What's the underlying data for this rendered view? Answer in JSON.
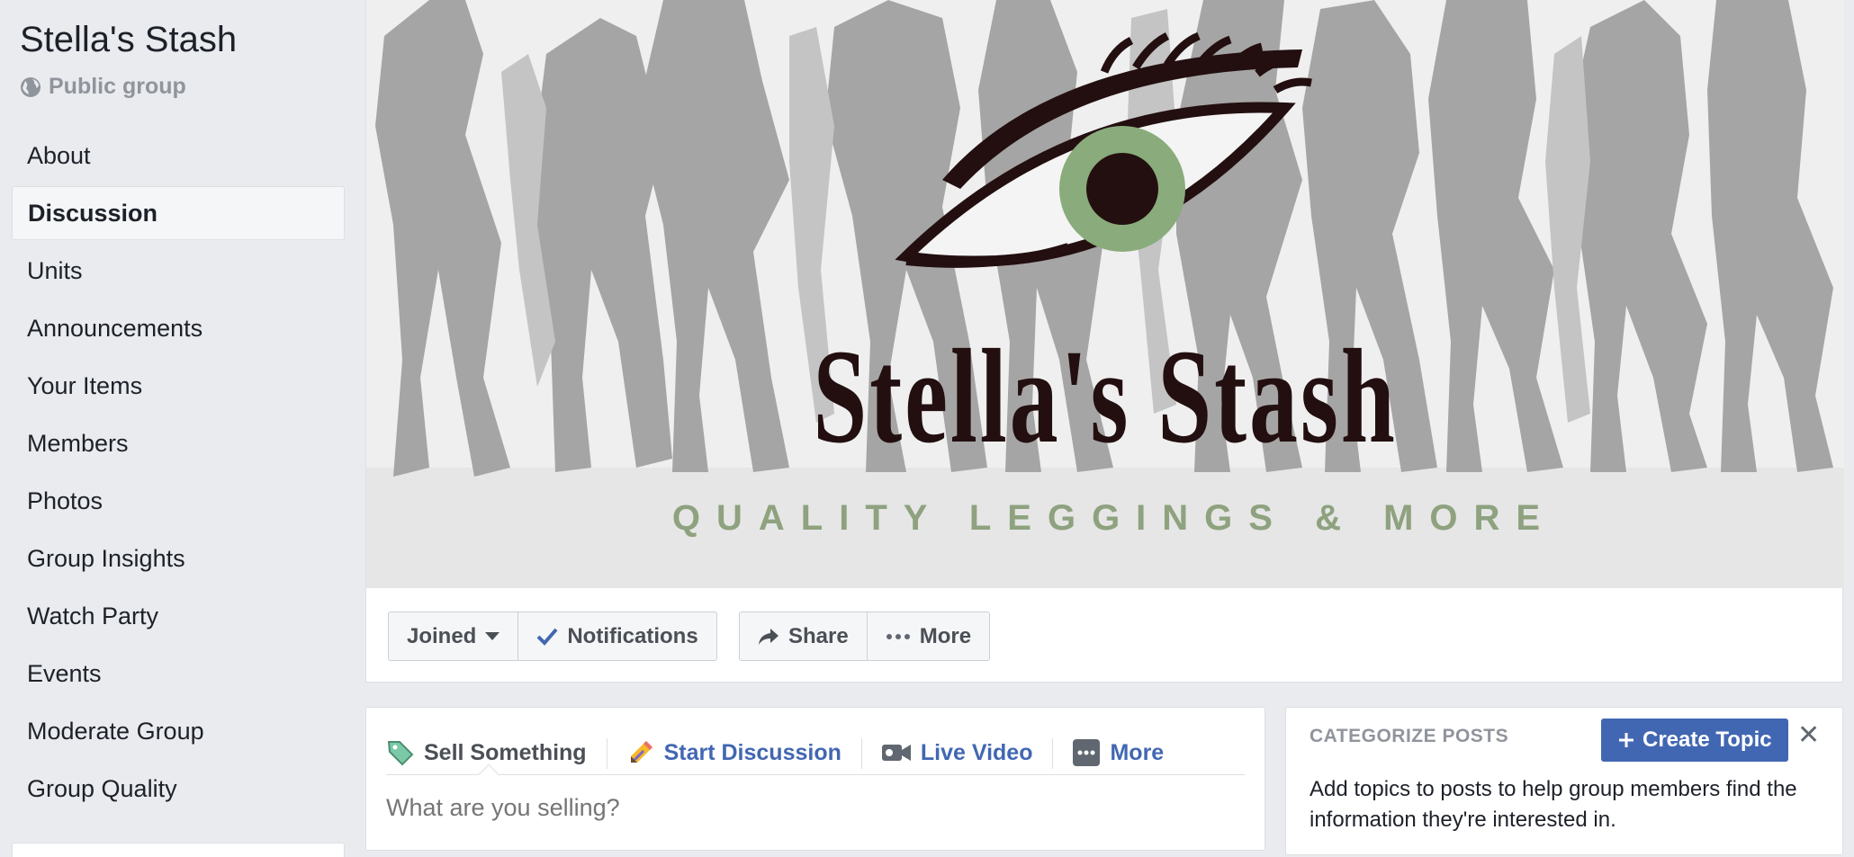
{
  "group": {
    "name": "Stella's Stash",
    "privacy": "Public group"
  },
  "sidebar": {
    "items": [
      {
        "label": "About",
        "active": false
      },
      {
        "label": "Discussion",
        "active": true
      },
      {
        "label": "Units",
        "active": false
      },
      {
        "label": "Announcements",
        "active": false
      },
      {
        "label": "Your Items",
        "active": false
      },
      {
        "label": "Members",
        "active": false
      },
      {
        "label": "Photos",
        "active": false
      },
      {
        "label": "Group Insights",
        "active": false
      },
      {
        "label": "Watch Party",
        "active": false
      },
      {
        "label": "Events",
        "active": false
      },
      {
        "label": "Moderate Group",
        "active": false
      },
      {
        "label": "Group Quality",
        "active": false
      }
    ]
  },
  "cover": {
    "title": "Stella's Stash",
    "tagline": "QUALITY LEGGINGS & MORE",
    "colors": {
      "iris": "#8aab7b",
      "ink": "#230f10",
      "silhouettes": "#a3a3a3"
    }
  },
  "actions": {
    "joined": "Joined",
    "notifications": "Notifications",
    "share": "Share",
    "more": "More"
  },
  "composer": {
    "tabs": {
      "sell": "Sell Something",
      "discussion": "Start Discussion",
      "live": "Live Video",
      "more": "More"
    },
    "placeholder": "What are you selling?"
  },
  "categorize": {
    "title": "CATEGORIZE POSTS",
    "create_button": "Create Topic",
    "description": "Add topics to posts to help group members find the information they're interested in."
  },
  "colors": {
    "brand": "#4267b2",
    "background": "#e9ebee",
    "check": "#4267b2"
  }
}
